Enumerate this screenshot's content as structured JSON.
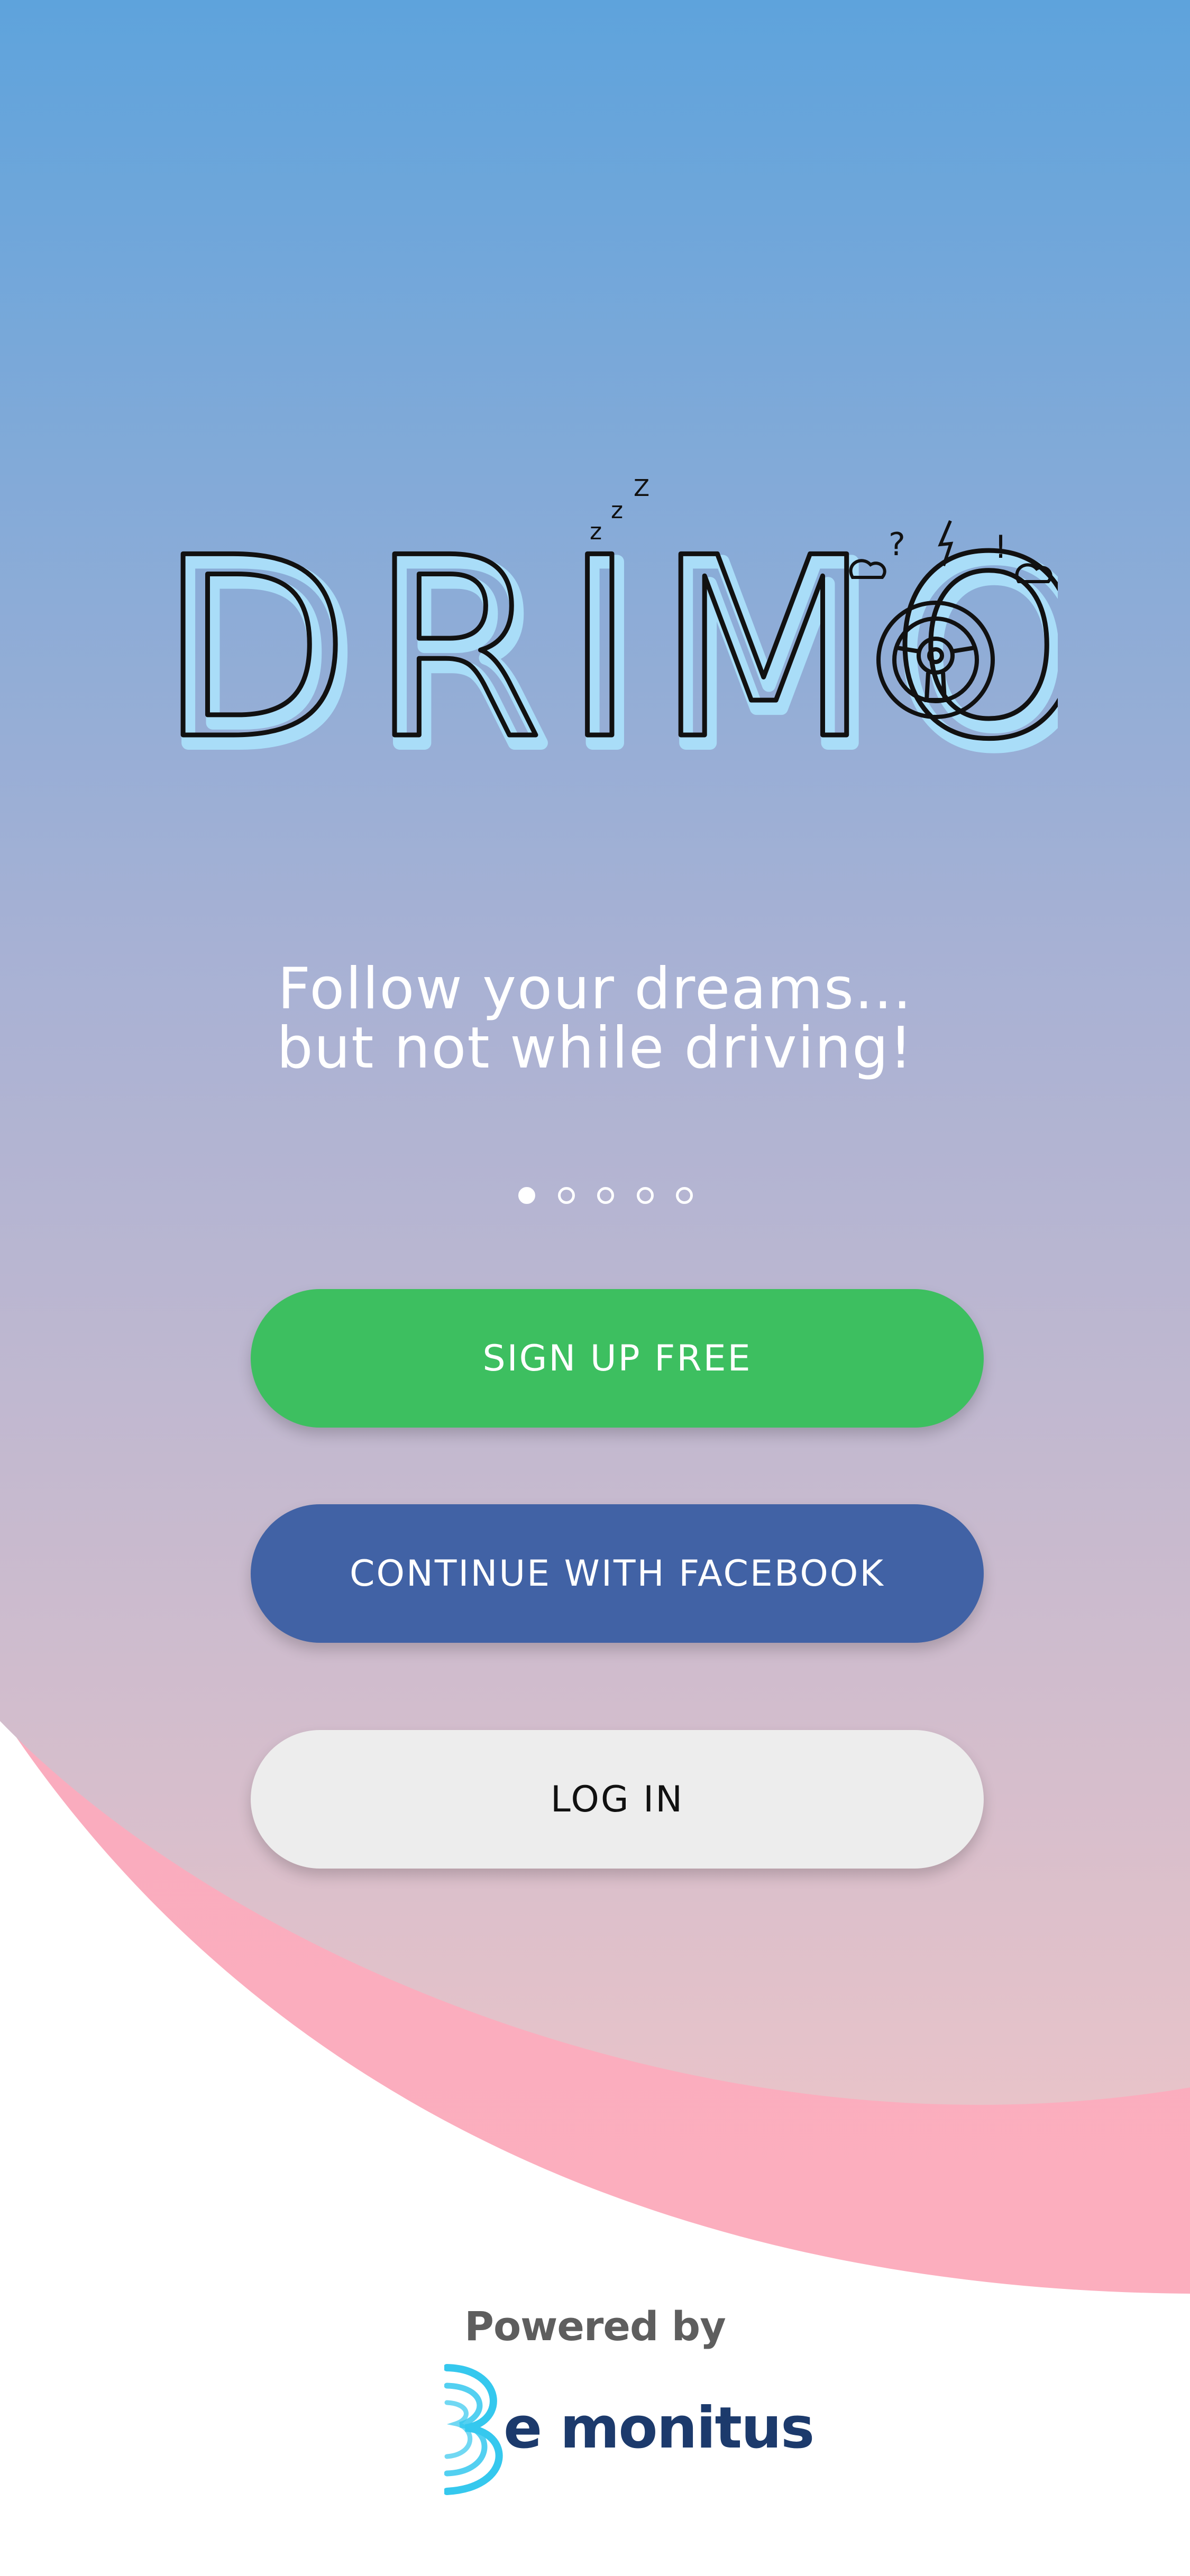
{
  "logo": {
    "text": "DRIMO",
    "snore_letters": [
      "z",
      "z",
      "Z"
    ],
    "stress_symbols": [
      "?",
      "!"
    ],
    "icon": "steering-wheel-icon"
  },
  "tagline": {
    "line1": "Follow your dreams...",
    "line2": "but not while driving!"
  },
  "carousel": {
    "total_pages": 5,
    "current_page": 1
  },
  "buttons": {
    "signup": "SIGN UP FREE",
    "facebook": "CONTINUE WITH FACEBOOK",
    "login": "LOG IN"
  },
  "footer": {
    "powered_by": "Powered by",
    "brand": "e monitus",
    "brand_icon": "be-monitus-logo-icon"
  },
  "colors": {
    "gradient_top": "#5ea3dc",
    "gradient_bottom": "#e8c3c9",
    "wave_pink": "#fbacbd",
    "signup": "#3dbf60",
    "facebook": "#4162a5",
    "login": "#ededed",
    "brand_navy": "#1c3a6c",
    "brand_cyan": "#35c8ee"
  }
}
